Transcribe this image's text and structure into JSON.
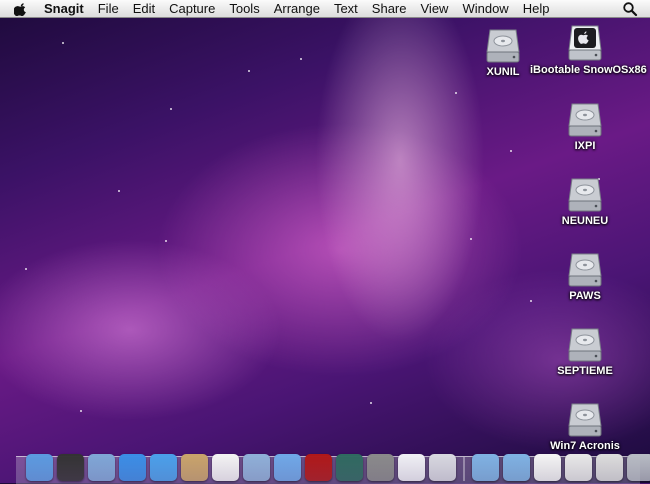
{
  "menubar": {
    "app_name": "Snagit",
    "items": [
      "File",
      "Edit",
      "Capture",
      "Tools",
      "Arrange",
      "Text",
      "Share",
      "View",
      "Window",
      "Help"
    ]
  },
  "desktop_icons": [
    {
      "label": "XUNIL",
      "icon": "hard-drive-icon"
    },
    {
      "label": "iBootable SnowOSx86",
      "icon": "apple-drive-icon"
    },
    {
      "label": "IXPI",
      "icon": "hard-drive-icon"
    },
    {
      "label": "NEUNEU",
      "icon": "hard-drive-icon"
    },
    {
      "label": "PAWS",
      "icon": "hard-drive-icon"
    },
    {
      "label": "SEPTIEME",
      "icon": "hard-drive-icon"
    },
    {
      "label": "Win7 Acronis",
      "icon": "hard-drive-icon"
    }
  ],
  "dock": {
    "apps": [
      {
        "icon": "finder-icon",
        "color": "#5b9be0"
      },
      {
        "icon": "dashboard-icon",
        "color": "#333333"
      },
      {
        "icon": "mail-icon",
        "color": "#7fa7d6"
      },
      {
        "icon": "safari-icon",
        "color": "#3a8ee6"
      },
      {
        "icon": "ichat-icon",
        "color": "#4aa0ea"
      },
      {
        "icon": "address-book-icon",
        "color": "#c9a46a"
      },
      {
        "icon": "ical-icon",
        "color": "#f3f3f3"
      },
      {
        "icon": "iphoto-icon",
        "color": "#8fb0d8"
      },
      {
        "icon": "itunes-icon",
        "color": "#6fa8e8"
      },
      {
        "icon": "photo-booth-icon",
        "color": "#b01818"
      },
      {
        "icon": "time-machine-icon",
        "color": "#2f6a60"
      },
      {
        "icon": "system-preferences-icon",
        "color": "#8a8a8a"
      },
      {
        "icon": "ralink-utility-icon",
        "color": "#f0f0f5"
      },
      {
        "icon": "preview-icon",
        "color": "#d8d8e0"
      }
    ],
    "stacks": [
      {
        "icon": "applications-folder-icon",
        "color": "#7fb2e3"
      },
      {
        "icon": "documents-folder-icon",
        "color": "#7fb2e3"
      },
      {
        "icon": "document-icon",
        "color": "#f4f4f4"
      },
      {
        "icon": "screenshot-icon",
        "color": "#e8e8e8"
      },
      {
        "icon": "screenshot-icon",
        "color": "#dcdcdc"
      },
      {
        "icon": "trash-icon",
        "color": "#b8bcc4"
      }
    ]
  }
}
